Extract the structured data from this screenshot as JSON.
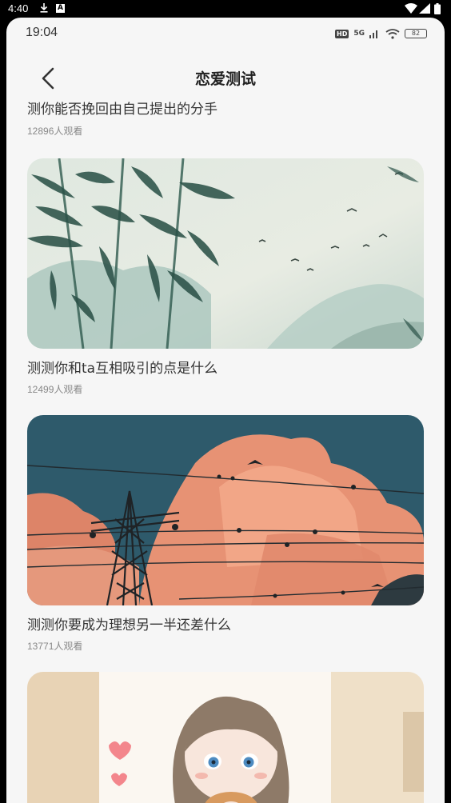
{
  "os_status": {
    "time": "4:40",
    "notification_label": "A"
  },
  "inner_status": {
    "time": "19:04",
    "hd_label": "HD",
    "network_label": "5G",
    "battery": "82"
  },
  "header": {
    "title": "恋爱测试"
  },
  "cards": [
    {
      "title": "测你能否挽回由自己提出的分手",
      "views": "12896人观看"
    },
    {
      "title": "测测你和ta互相吸引的点是什么",
      "views": "12499人观看",
      "image": "bamboo-ink-painting"
    },
    {
      "title": "测测你要成为理想另一半还差什么",
      "views": "13771人观看",
      "image": "power-lines-sunset-sky"
    },
    {
      "image": "anime-girl-illustration"
    }
  ],
  "colors": {
    "background": "#f6f6f6",
    "title_text": "#333333",
    "views_text": "#888888"
  }
}
